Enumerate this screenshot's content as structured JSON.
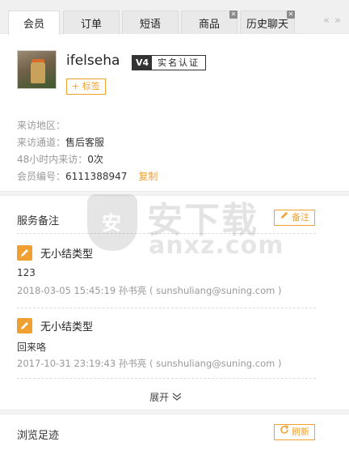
{
  "tabs": [
    {
      "label": "会员",
      "active": true,
      "closable": false
    },
    {
      "label": "订单",
      "active": false,
      "closable": false
    },
    {
      "label": "短语",
      "active": false,
      "closable": false
    },
    {
      "label": "商品",
      "active": false,
      "closable": true
    },
    {
      "label": "历史聊天",
      "active": false,
      "closable": true
    }
  ],
  "tab_scroll": {
    "prev": "«",
    "next": "»"
  },
  "profile": {
    "username": "ifelseha",
    "level": "V4",
    "verify_label": "实名认证",
    "tag_button": "+ 标签"
  },
  "info": {
    "region_label": "来访地区：",
    "region_value": "",
    "channel_label": "来访通道：",
    "channel_value": "售后客服",
    "visits_label": "48小时内来访：",
    "visits_value": "0次",
    "member_id_label": "会员编号：",
    "member_id_value": "6111388947",
    "copy_label": "复制"
  },
  "service_notes": {
    "title": "服务备注",
    "add_button": "备注",
    "items": [
      {
        "type": "无小结类型",
        "text": "123",
        "meta": "2018-03-05 15:45:19 孙书亮 ( sunshuliang@suning.com )"
      },
      {
        "type": "无小结类型",
        "text": "回来咯",
        "meta": "2017-10-31 23:19:43 孙书亮 ( sunshuliang@suning.com )"
      }
    ],
    "expand_label": "展开"
  },
  "footprints": {
    "title": "浏览足迹",
    "refresh_button": "刷新"
  },
  "watermark": {
    "line1": "安下载",
    "line2": "anxz.com",
    "shield_char": "安"
  },
  "colors": {
    "accent": "#f0a031",
    "badge_dark": "#333333"
  }
}
